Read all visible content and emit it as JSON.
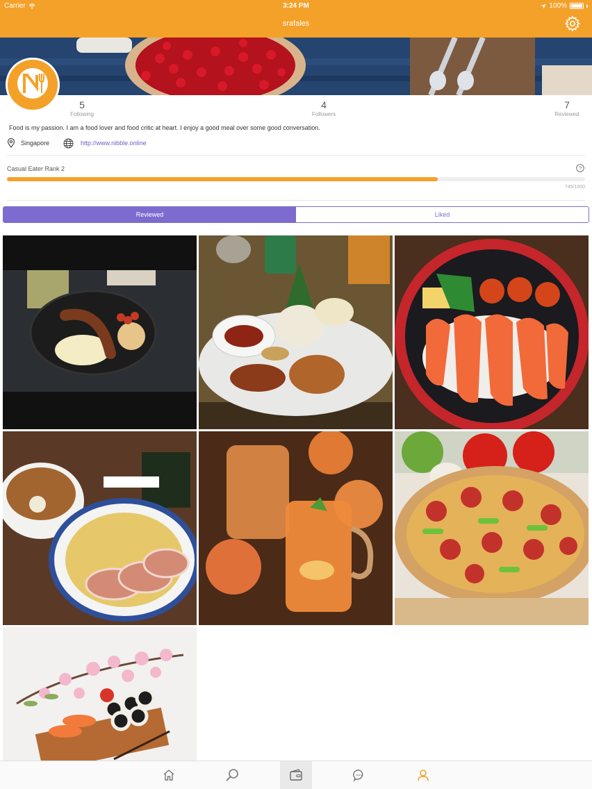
{
  "status_bar": {
    "carrier": "Carrier",
    "time": "3:24 PM",
    "battery": "100%"
  },
  "nav": {
    "title": "srafales"
  },
  "profile": {
    "stats": [
      {
        "value": "5",
        "label": "Following"
      },
      {
        "value": "4",
        "label": "Followers"
      },
      {
        "value": "7",
        "label": "Reviewed"
      }
    ],
    "bio": "Food is my passion. I am a food lover and food critic at heart.  I enjoy a good meal over some good conversation.",
    "location": "Singapore",
    "website": "http://www.nibble.online"
  },
  "rank": {
    "label": "Casual Eater Rank 2",
    "progress_text": "745/1000",
    "progress": 0.745
  },
  "segments": {
    "reviewed": "Reviewed",
    "liked": "Liked",
    "active": "reviewed"
  },
  "photos": [
    {
      "name": "breakfast-sausage-plate"
    },
    {
      "name": "nasi-tumpeng-chicken-plate"
    },
    {
      "name": "salmon-sashimi-bowl"
    },
    {
      "name": "tsukemen-ramen"
    },
    {
      "name": "peach-iced-tea"
    },
    {
      "name": "pepperoni-pizza"
    },
    {
      "name": "sushi-platter"
    }
  ],
  "tabbar": {
    "items": [
      {
        "icon": "home-icon"
      },
      {
        "icon": "search-icon"
      },
      {
        "icon": "wallet-icon",
        "active": true
      },
      {
        "icon": "chat-icon"
      },
      {
        "icon": "profile-icon"
      }
    ]
  },
  "colors": {
    "brand": "#f4a12a",
    "accent": "#7e6bcf"
  }
}
